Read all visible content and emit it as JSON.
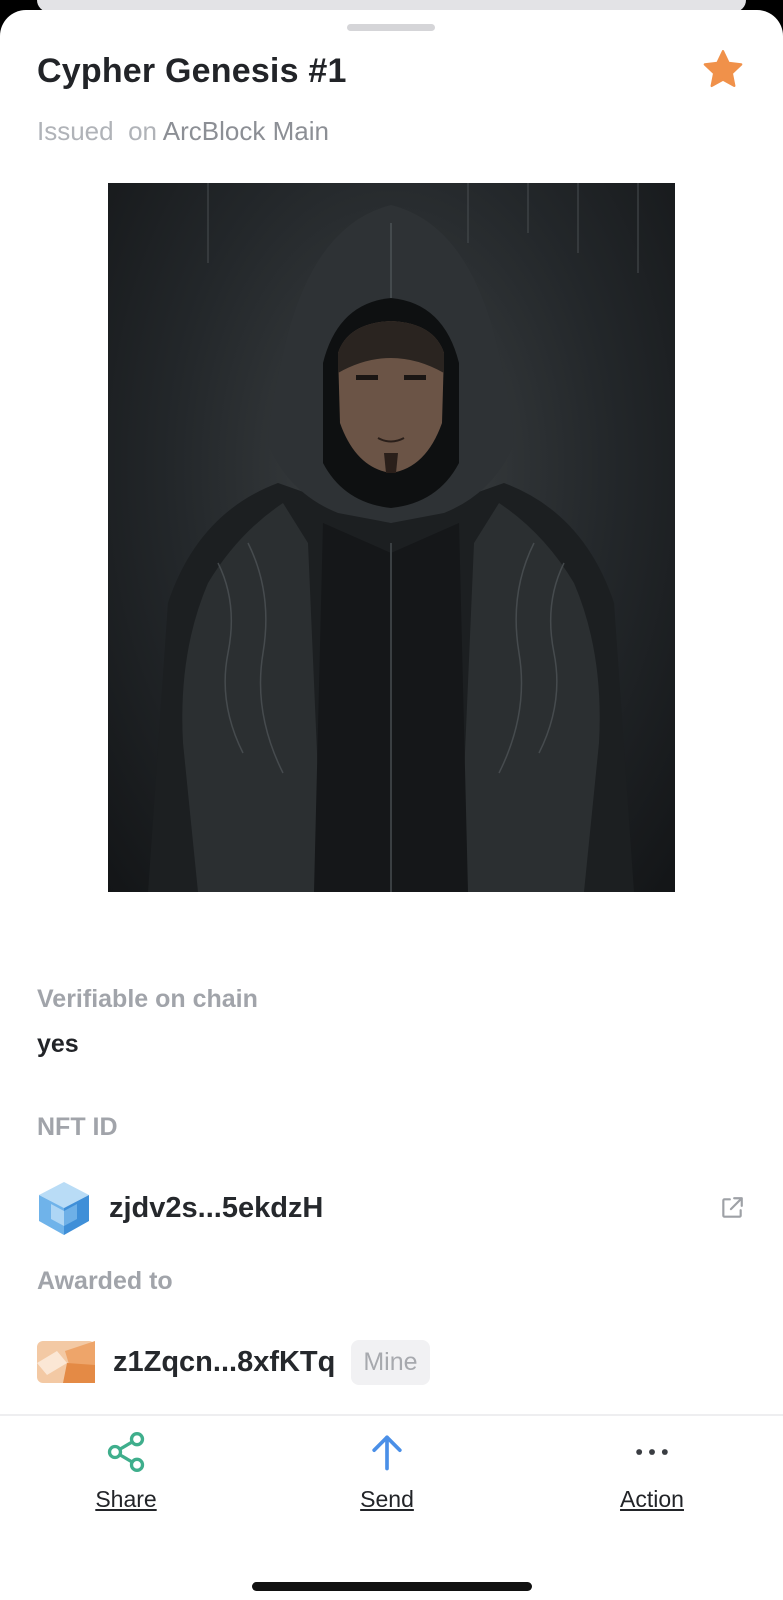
{
  "header": {
    "title": "Cypher Genesis #1",
    "issued_word": "Issued",
    "on_word": "on",
    "chain_name": "ArcBlock Main",
    "star_icon": "star-icon",
    "favorite_color": "#f0914a"
  },
  "artwork": {
    "subject_icon": "hooded-figure-illustration"
  },
  "details": {
    "verifiable": {
      "label": "Verifiable on chain",
      "value": "yes"
    },
    "nft_id": {
      "label": "NFT ID",
      "value": "zjdv2s...5ekdzH",
      "avatar_icon": "cube-avatar-icon",
      "link_icon": "external-link-icon"
    },
    "awarded_to": {
      "label": "Awarded to",
      "value": "z1Zqcn...8xfKTq",
      "badge": "Mine",
      "avatar_icon": "owner-avatar-icon"
    }
  },
  "bottom_bar": {
    "share": {
      "label": "Share",
      "icon": "share-icon",
      "color": "#3fae8c"
    },
    "send": {
      "label": "Send",
      "icon": "arrow-up-icon",
      "color": "#4a8fe7"
    },
    "action": {
      "label": "Action",
      "icon": "more-dots-icon",
      "color": "#3a3d42"
    }
  }
}
